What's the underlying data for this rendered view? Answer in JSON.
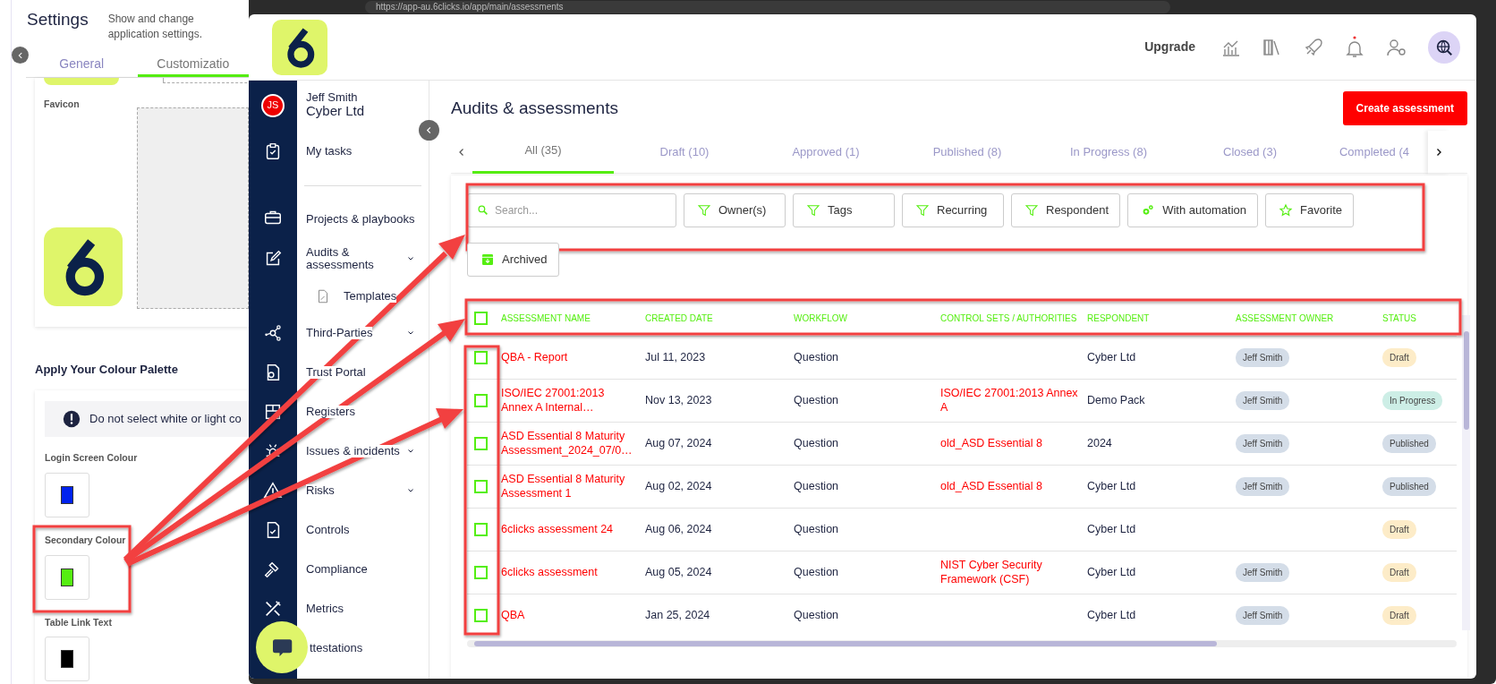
{
  "settings": {
    "title": "Settings",
    "subtitle": "Show and change application settings.",
    "tabs": [
      {
        "label": "General",
        "selected": false
      },
      {
        "label": "Customizatio",
        "selected": true
      }
    ],
    "favicon_label": "Favicon",
    "palette_heading": "Apply Your Colour Palette",
    "warning": "Do not select white or light co",
    "colours": [
      {
        "label": "Login Screen Colour",
        "color": "#0022ee"
      },
      {
        "label": "Secondary Colour",
        "color": "#55ee11"
      },
      {
        "label": "Table Link Text",
        "color": "#000000"
      }
    ]
  },
  "browser": {
    "url": "https://app-au.6clicks.io/app/main/assessments"
  },
  "header": {
    "upgrade": "Upgrade",
    "avatar_initials": "JS",
    "notifications": true
  },
  "user": {
    "name": "Jeff Smith",
    "org": "Cyber Ltd"
  },
  "nav": [
    {
      "label": "My tasks",
      "expandable": false
    },
    {
      "label": "Projects & playbooks",
      "expandable": false
    },
    {
      "label": "Audits & assessments",
      "expandable": true,
      "children": [
        {
          "label": "Templates"
        }
      ]
    },
    {
      "label": "Third-Parties",
      "expandable": true
    },
    {
      "label": "Trust Portal",
      "expandable": false
    },
    {
      "label": "Registers",
      "expandable": false
    },
    {
      "label": "Issues & incidents",
      "expandable": true
    },
    {
      "label": "Risks",
      "expandable": true
    },
    {
      "label": "Controls",
      "expandable": false
    },
    {
      "label": "Compliance",
      "expandable": false
    },
    {
      "label": "Metrics",
      "expandable": false
    },
    {
      "label": "ttestations",
      "expandable": false
    }
  ],
  "page": {
    "title": "Audits & assessments",
    "create_button": "Create assessment"
  },
  "tabs": [
    {
      "label": "All (35)",
      "selected": true
    },
    {
      "label": "Draft (10)",
      "selected": false
    },
    {
      "label": "Approved (1)",
      "selected": false
    },
    {
      "label": "Published (8)",
      "selected": false
    },
    {
      "label": "In Progress (8)",
      "selected": false
    },
    {
      "label": "Closed (3)",
      "selected": false
    },
    {
      "label": "Completed (4",
      "selected": false
    }
  ],
  "search": {
    "placeholder": "Search..."
  },
  "filters": [
    {
      "label": "Owner(s)",
      "kind": "filter"
    },
    {
      "label": "Tags",
      "kind": "filter"
    },
    {
      "label": "Recurring",
      "kind": "filter"
    },
    {
      "label": "Respondent",
      "kind": "filter"
    },
    {
      "label": "With automation",
      "kind": "automation"
    },
    {
      "label": "Favorite",
      "kind": "favorite"
    },
    {
      "label": "Archived",
      "kind": "archive"
    }
  ],
  "table": {
    "all_checked": false,
    "columns": [
      "ASSESSMENT NAME",
      "CREATED DATE",
      "WORKFLOW",
      "CONTROL SETS / AUTHORITIES",
      "RESPONDENT",
      "ASSESSMENT OWNER",
      "STATUS"
    ],
    "rows": [
      {
        "checked": false,
        "name": "QBA - Report",
        "created": "Jul 11, 2023",
        "workflow": "Question",
        "respondent": "Cyber Ltd",
        "owner": "Jeff Smith",
        "status": {
          "label": "Draft",
          "color": "#fdecc8"
        }
      },
      {
        "checked": false,
        "name": "ISO/IEC 27001:2013 Annex A Internal…",
        "created": "Nov 13, 2023",
        "workflow": "Question",
        "control_sets": "ISO/IEC 27001:2013 Annex A",
        "respondent": "Demo Pack",
        "owner": "Jeff Smith",
        "status": {
          "label": "In Progress",
          "color": "#cdeee6"
        }
      },
      {
        "checked": false,
        "name": "ASD Essential 8 Maturity Assessment_2024_07/0…",
        "created": "Aug 07, 2024",
        "workflow": "Question",
        "control_sets": "old_ASD Essential 8",
        "respondent": "2024",
        "owner": "Jeff Smith",
        "status": {
          "label": "Published",
          "color": "#d4dde8"
        }
      },
      {
        "checked": false,
        "name": "ASD Essential 8 Maturity Assessment 1",
        "created": "Aug 02, 2024",
        "workflow": "Question",
        "control_sets": "old_ASD Essential 8",
        "respondent": "Cyber Ltd",
        "owner": "Jeff Smith",
        "status": {
          "label": "Published",
          "color": "#d4dde8"
        }
      },
      {
        "checked": false,
        "name": "6clicks assessment 24",
        "created": "Aug 06, 2024",
        "workflow": "Question",
        "respondent": "Cyber Ltd",
        "status": {
          "label": "Draft",
          "color": "#fdecc8"
        }
      },
      {
        "checked": false,
        "name": "6clicks assessment",
        "created": "Aug 05, 2024",
        "workflow": "Question",
        "control_sets": "NIST Cyber Security Framework (CSF)",
        "respondent": "Cyber Ltd",
        "owner": "Jeff Smith",
        "status": {
          "label": "Draft",
          "color": "#fdecc8"
        }
      },
      {
        "checked": false,
        "name": "QBA",
        "created": "Jan 25, 2024",
        "workflow": "Question",
        "respondent": "Cyber Ltd",
        "owner": "Jeff Smith",
        "status": {
          "label": "Draft",
          "color": "#fdecc8"
        }
      }
    ]
  }
}
